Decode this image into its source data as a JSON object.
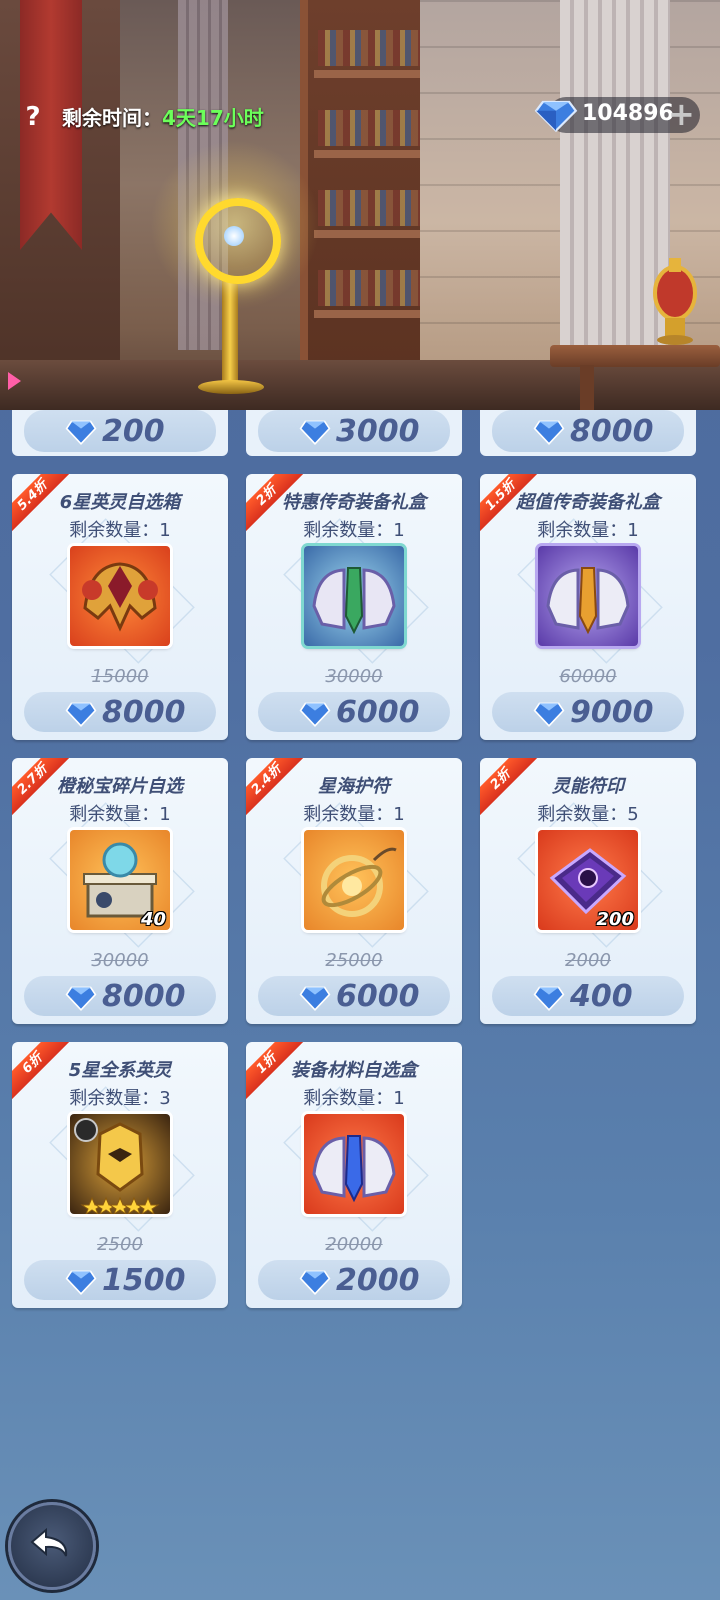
{
  "header": {
    "help_label": "?",
    "time_label": "剩余时间：",
    "time_value": "4天17小时",
    "gem_count": "104896",
    "plus_label": "+"
  },
  "top_prices": [
    "200",
    "3000",
    "8000"
  ],
  "items": [
    {
      "discount": "5.4折",
      "name": "6星英灵自选箱",
      "stock": "剩余数量：1",
      "qty": "",
      "old_price": "15000",
      "price": "8000",
      "art": "helm-red"
    },
    {
      "discount": "2折",
      "name": "特惠传奇装备礼盒",
      "stock": "剩余数量：1",
      "qty": "",
      "old_price": "30000",
      "price": "6000",
      "art": "armor-blue"
    },
    {
      "discount": "1.5折",
      "name": "超值传奇装备礼盒",
      "stock": "剩余数量：1",
      "qty": "",
      "old_price": "60000",
      "price": "9000",
      "art": "armor-purple"
    },
    {
      "discount": "2.7折",
      "name": "橙秘宝碎片自选",
      "stock": "剩余数量：1",
      "qty": "40",
      "old_price": "30000",
      "price": "8000",
      "art": "orb-gold"
    },
    {
      "discount": "2.4折",
      "name": "星海护符",
      "stock": "剩余数量：1",
      "qty": "",
      "old_price": "25000",
      "price": "6000",
      "art": "amulet"
    },
    {
      "discount": "2折",
      "name": "灵能符印",
      "stock": "剩余数量：5",
      "qty": "200",
      "old_price": "2000",
      "price": "400",
      "art": "rune-purple"
    },
    {
      "discount": "6折",
      "name": "5星全系英灵",
      "stock": "剩余数量：3",
      "qty": "",
      "old_price": "2500",
      "price": "1500",
      "art": "hero-all"
    },
    {
      "discount": "1折",
      "name": "装备材料自选盒",
      "stock": "剩余数量：1",
      "qty": "",
      "old_price": "20000",
      "price": "2000",
      "art": "armor-orange"
    }
  ],
  "colors": {
    "ribbon": "#e0371f",
    "time_green": "#6cff5a",
    "price_text": "#4a5e92",
    "card_bg": "#eef5fc"
  }
}
